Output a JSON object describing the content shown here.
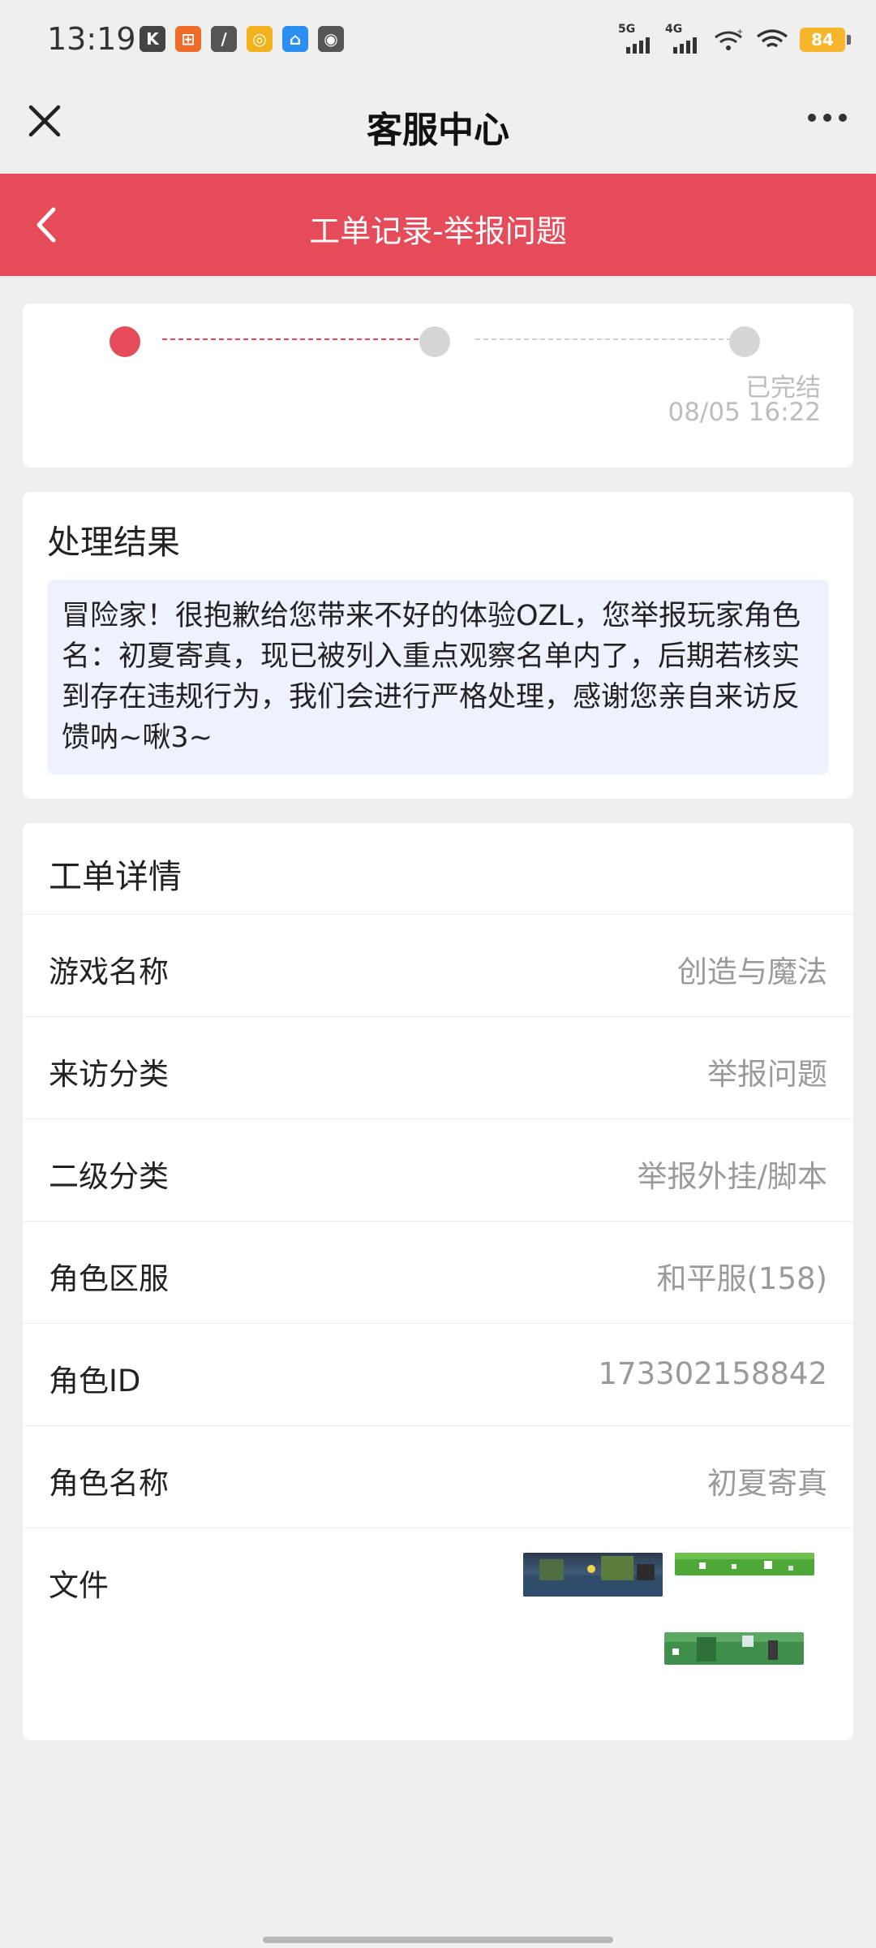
{
  "status": {
    "time": "13:19",
    "signal_1_label": "5G",
    "signal_2_label": "4G",
    "battery": "84"
  },
  "titlebar": {
    "title": "客服中心"
  },
  "header": {
    "title": "工单记录-举报问题"
  },
  "progress": {
    "steps": [
      {
        "state": "active"
      },
      {
        "state": "pending"
      },
      {
        "state": "pending",
        "label": "已完结",
        "time": "08/05 16:22"
      }
    ]
  },
  "result": {
    "title": "处理结果",
    "text": "冒险家！很抱歉给您带来不好的体验OZL，您举报玩家角色名：初夏寄真，现已被列入重点观察名单内了，后期若核实到存在违规行为，我们会进行严格处理，感谢您亲自来访反馈呐~啾3~"
  },
  "details": {
    "title": "工单详情",
    "rows": [
      {
        "key": "游戏名称",
        "value": "创造与魔法"
      },
      {
        "key": "来访分类",
        "value": "举报问题"
      },
      {
        "key": "二级分类",
        "value": "举报外挂/脚本"
      },
      {
        "key": "角色区服",
        "value": "和平服(158)"
      },
      {
        "key": "角色ID",
        "value": "173302158842"
      },
      {
        "key": "角色名称",
        "value": "初夏寄真"
      }
    ],
    "files_label": "文件"
  },
  "colors": {
    "accent": "#e64b5a",
    "background": "#efefef",
    "result_box": "#eef2fd"
  }
}
